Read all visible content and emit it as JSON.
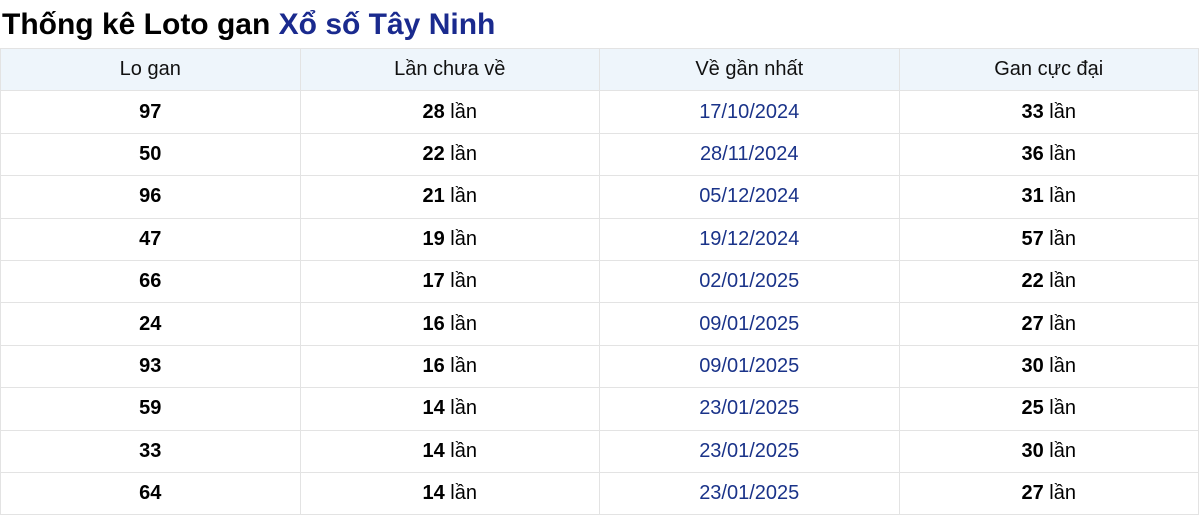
{
  "title": {
    "prefix": "Thống kê Loto gan",
    "highlight": "Xổ số Tây Ninh"
  },
  "columns": [
    "Lo gan",
    "Lần chưa về",
    "Về gần nhất",
    "Gan cực đại"
  ],
  "unit": "lần",
  "rows": [
    {
      "lo": "97",
      "missing": "28",
      "last": "17/10/2024",
      "max": "33"
    },
    {
      "lo": "50",
      "missing": "22",
      "last": "28/11/2024",
      "max": "36"
    },
    {
      "lo": "96",
      "missing": "21",
      "last": "05/12/2024",
      "max": "31"
    },
    {
      "lo": "47",
      "missing": "19",
      "last": "19/12/2024",
      "max": "57"
    },
    {
      "lo": "66",
      "missing": "17",
      "last": "02/01/2025",
      "max": "22"
    },
    {
      "lo": "24",
      "missing": "16",
      "last": "09/01/2025",
      "max": "27"
    },
    {
      "lo": "93",
      "missing": "16",
      "last": "09/01/2025",
      "max": "30"
    },
    {
      "lo": "59",
      "missing": "14",
      "last": "23/01/2025",
      "max": "25"
    },
    {
      "lo": "33",
      "missing": "14",
      "last": "23/01/2025",
      "max": "30"
    },
    {
      "lo": "64",
      "missing": "14",
      "last": "23/01/2025",
      "max": "27"
    }
  ],
  "colors": {
    "accent": "#1a2a8e",
    "date": "#1a3389",
    "header_bg": "#eef5fb",
    "border": "#e3e3e3"
  }
}
